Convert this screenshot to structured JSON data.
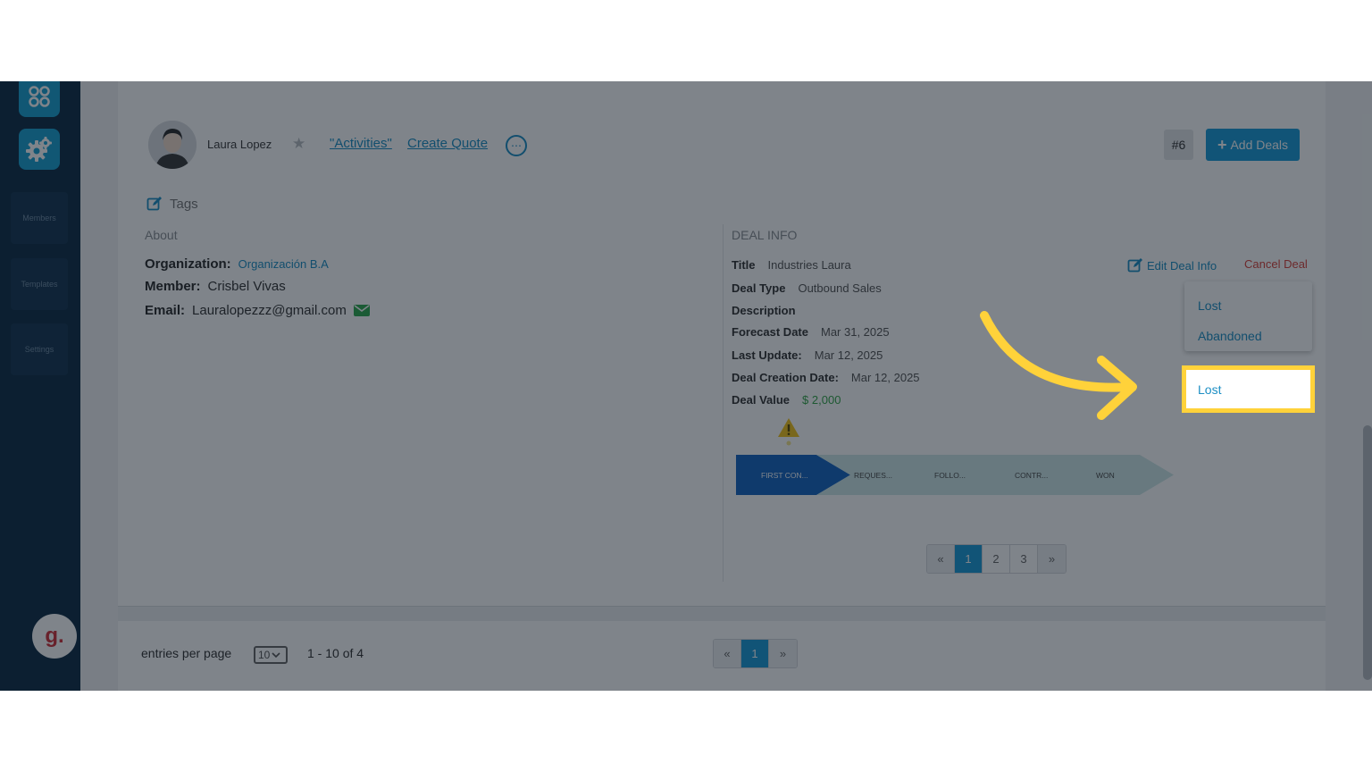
{
  "sidebar": {
    "items": [
      {
        "label": "Members"
      },
      {
        "label": "Templates"
      },
      {
        "label": "Settings"
      }
    ],
    "logo_letter": "g."
  },
  "contact": {
    "name": "Laura Lopez",
    "activities_link": "\"Activities\"",
    "create_quote_link": "Create Quote",
    "more_icon": "⋯"
  },
  "header": {
    "deal_number": "#6",
    "add_deals_label": "Add Deals",
    "add_icon": "+"
  },
  "tags": {
    "label": "Tags"
  },
  "about": {
    "heading": "About",
    "organization_label": "Organization:",
    "organization_value": "Organización B.A",
    "member_label": "Member:",
    "member_value": "Crisbel Vivas",
    "email_label": "Email:",
    "email_value": "Lauralopezzz@gmail.com"
  },
  "deal_info": {
    "heading": "DEAL INFO",
    "edit_label": "Edit Deal Info",
    "cancel_label": "Cancel Deal",
    "rows": [
      {
        "label": "Title",
        "value": "Industries Laura"
      },
      {
        "label": "Deal Type",
        "value": "Outbound Sales"
      },
      {
        "label": "Description",
        "value": ""
      },
      {
        "label": "Forecast Date",
        "value": "Mar 31, 2025"
      },
      {
        "label": "Last Update:",
        "value": "Mar 12, 2025"
      },
      {
        "label": "Deal Creation Date:",
        "value": "Mar 12, 2025"
      },
      {
        "label": "Deal Value",
        "value": "$ 2,000"
      }
    ]
  },
  "cancel_menu": {
    "items": [
      "Lost",
      "Abandoned"
    ]
  },
  "stages": [
    "FIRST CON...",
    "REQUES...",
    "FOLLO...",
    "CONTR...",
    "WON"
  ],
  "deal_pager": {
    "prev": "«",
    "pages": [
      "1",
      "2",
      "3"
    ],
    "next": "»"
  },
  "footer": {
    "entries_label": "entries per page",
    "per_page_value": "10",
    "range_text": "1 - 10 of 4",
    "pager": {
      "prev": "«",
      "pages": [
        "1"
      ],
      "next": "»"
    }
  },
  "colors": {
    "sidebar": "#0f2d46",
    "accent": "#1a9bd7",
    "cancel": "#d9433b",
    "highlight": "#ffd23a",
    "stage_active": "#1565c0",
    "stage_inactive": "#cfe9e8"
  }
}
